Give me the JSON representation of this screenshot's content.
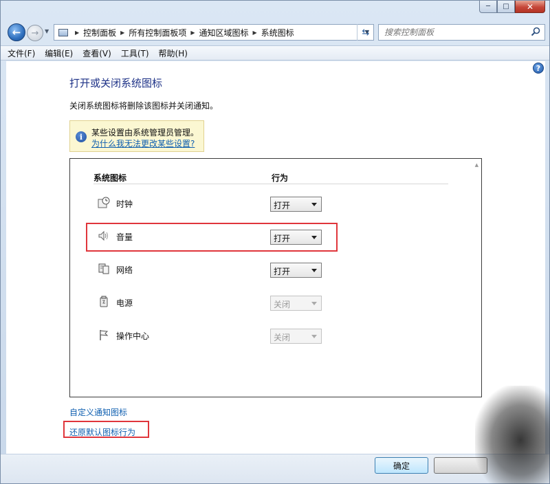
{
  "window": {
    "caption_minimize": "─",
    "caption_maximize": "□",
    "caption_close": "✕"
  },
  "address_bar": {
    "breadcrumbs": [
      "控制面板",
      "所有控制面板项",
      "通知区域图标",
      "系统图标"
    ],
    "search_placeholder": "搜索控制面板"
  },
  "menu": {
    "items": [
      "文件(F)",
      "编辑(E)",
      "查看(V)",
      "工具(T)",
      "帮助(H)"
    ]
  },
  "page": {
    "title": "打开或关闭系统图标",
    "description": "关闭系统图标将删除该图标并关闭通知。",
    "info_text": "某些设置由系统管理员管理。",
    "info_link": "为什么我无法更改某些设置?",
    "help_glyph": "?",
    "info_glyph": "i"
  },
  "table": {
    "col_icon": "系统图标",
    "col_behavior": "行为",
    "rows": [
      {
        "label": "时钟",
        "value": "打开",
        "enabled": true,
        "icon": "clock-icon"
      },
      {
        "label": "音量",
        "value": "打开",
        "enabled": true,
        "icon": "volume-icon"
      },
      {
        "label": "网络",
        "value": "打开",
        "enabled": true,
        "icon": "network-icon"
      },
      {
        "label": "电源",
        "value": "关闭",
        "enabled": false,
        "icon": "power-icon"
      },
      {
        "label": "操作中心",
        "value": "关闭",
        "enabled": false,
        "icon": "flag-icon"
      }
    ]
  },
  "links": {
    "customize": "自定义通知图标",
    "restore": "还原默认图标行为"
  },
  "buttons": {
    "ok": "确定",
    "cancel": ""
  },
  "colors": {
    "highlight": "#e0353b",
    "link": "#0f5fb0",
    "title": "#1e3287"
  }
}
